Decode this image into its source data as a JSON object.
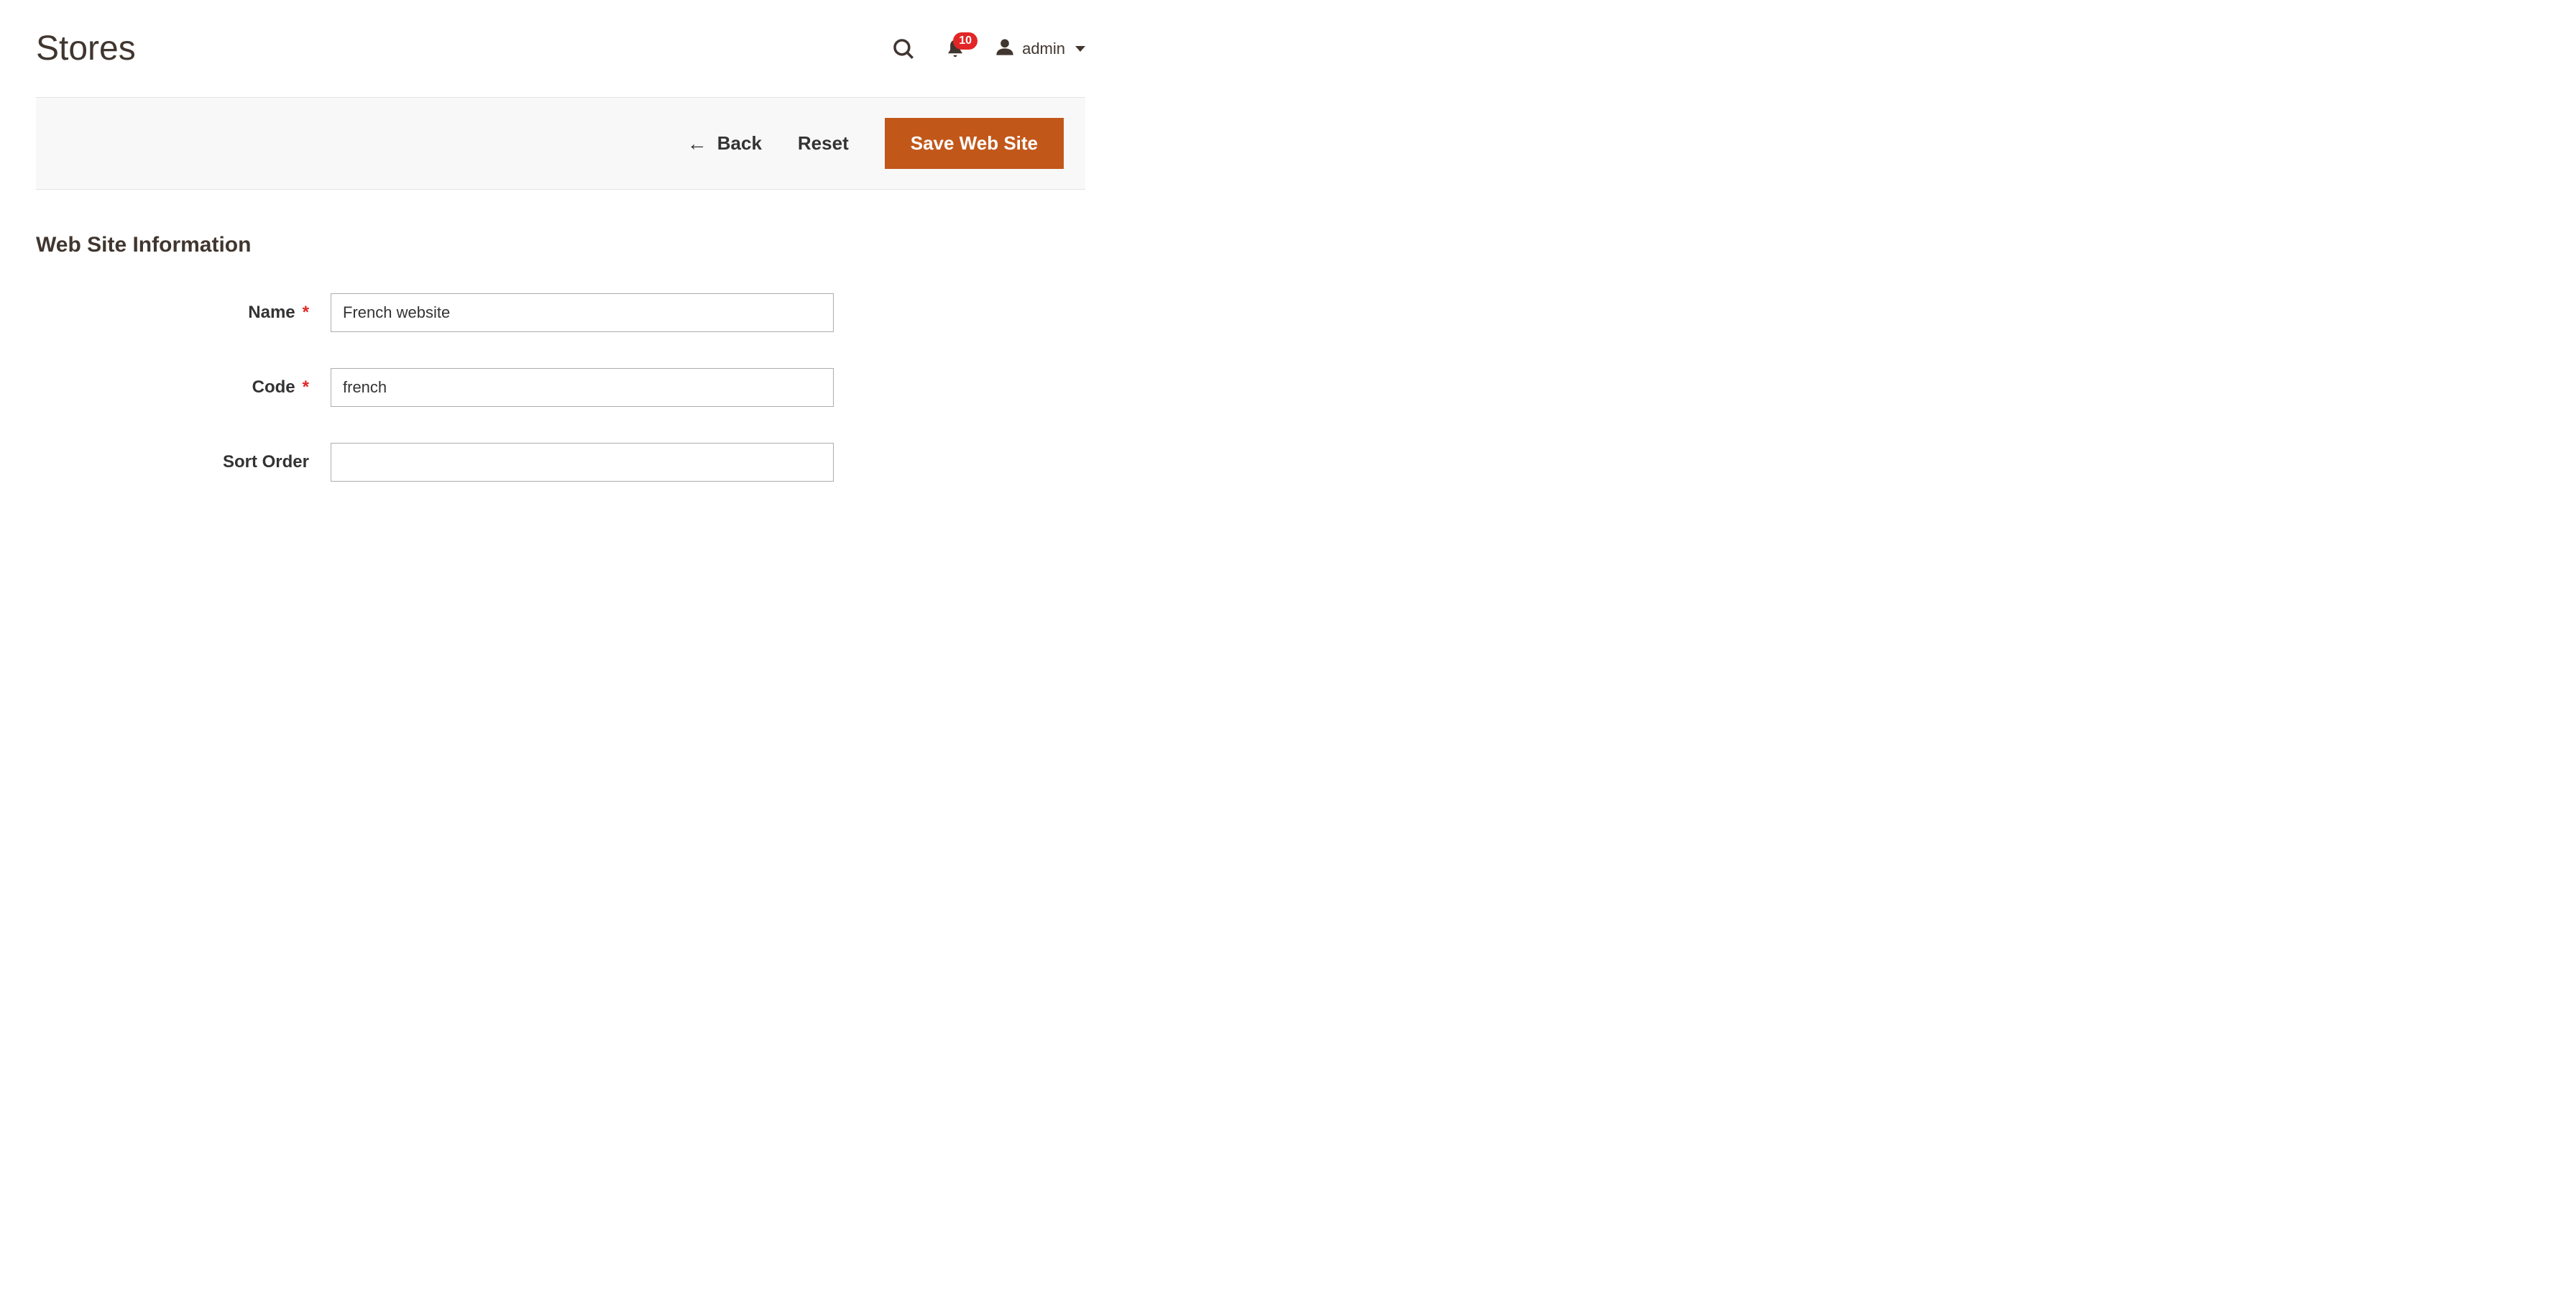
{
  "header": {
    "title": "Stores",
    "notifications_count": "10",
    "user_name": "admin"
  },
  "toolbar": {
    "back_label": "Back",
    "reset_label": "Reset",
    "save_label": "Save Web Site"
  },
  "section": {
    "title": "Web Site Information"
  },
  "form": {
    "name": {
      "label": "Name",
      "value": "French website",
      "required": true
    },
    "code": {
      "label": "Code",
      "value": "french",
      "required": true
    },
    "sort_order": {
      "label": "Sort Order",
      "value": "",
      "required": false
    }
  }
}
